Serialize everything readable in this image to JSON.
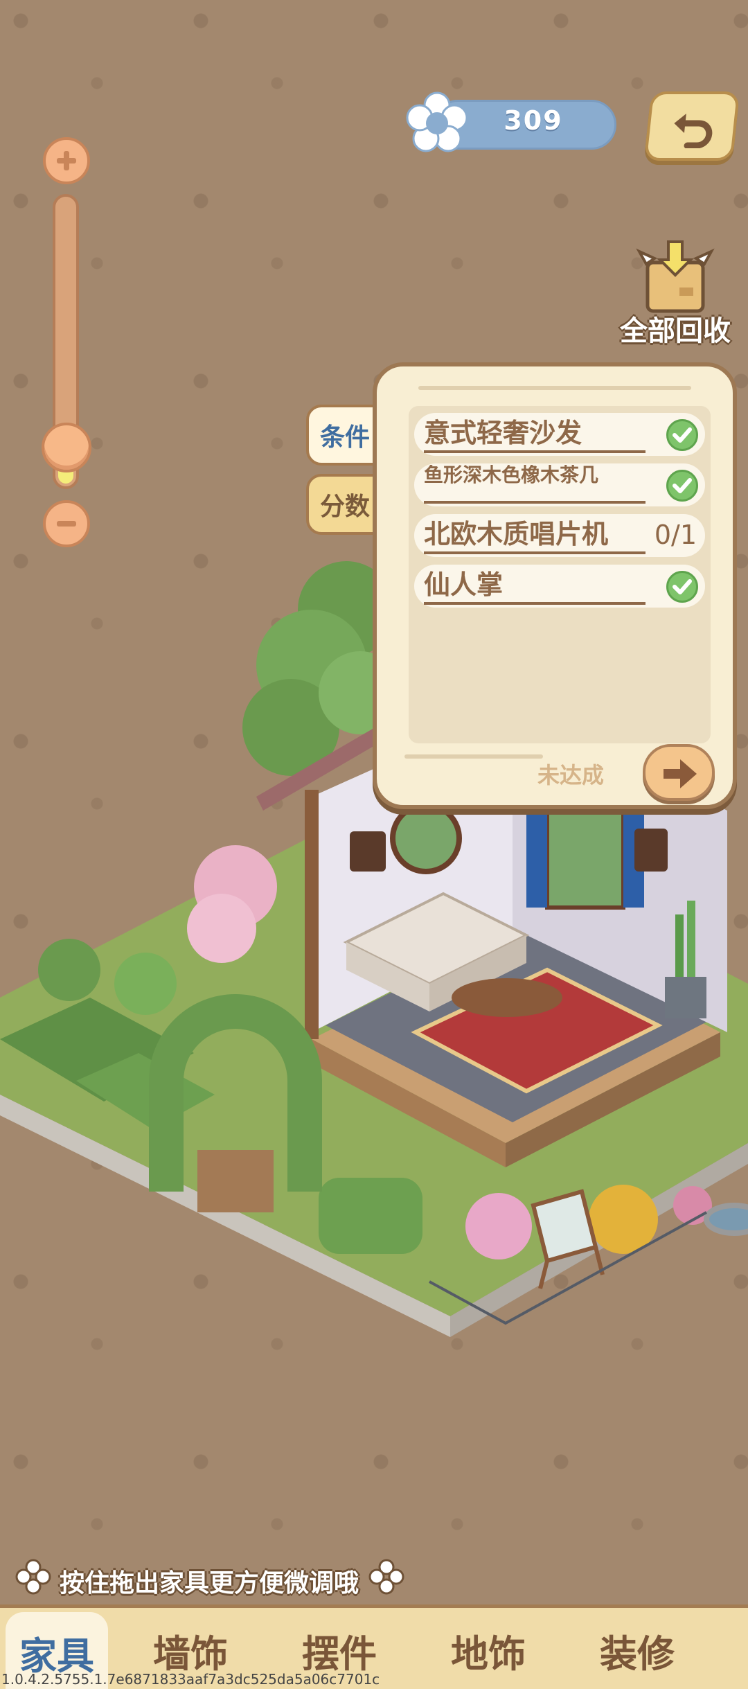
{
  "currency": {
    "value": "309",
    "icon": "flower-icon"
  },
  "back_button": {
    "icon": "undo-arrow-icon"
  },
  "recycle": {
    "label": "全部回收",
    "icon": "cardboard-box-icon"
  },
  "zoom": {
    "plus_icon": "plus-icon",
    "minus_icon": "minus-icon",
    "level": 0.14
  },
  "panel": {
    "tabs": [
      {
        "label": "条件"
      },
      {
        "label": "分数"
      }
    ],
    "tasks": [
      {
        "name": "意式轻奢沙发",
        "done": true
      },
      {
        "name": "鱼形深木色橡木茶几",
        "done": true
      },
      {
        "name": "北欧木质唱片机",
        "progress": "0/1",
        "done": false
      },
      {
        "name": "仙人掌",
        "done": true
      }
    ],
    "status": "未达成",
    "go_icon": "right-arrow-icon"
  },
  "hint": {
    "text": "按住拖出家具更方便微调哦"
  },
  "nav": {
    "items": [
      {
        "label": "家具"
      },
      {
        "label": "墙饰"
      },
      {
        "label": "摆件"
      },
      {
        "label": "地饰"
      },
      {
        "label": "装修"
      }
    ]
  },
  "version": "1.0.4.2.5755.1.7e6871833aaf7a3dc525da5a06c7701c",
  "colors": {
    "background": "#a3886e",
    "accent_blue": "#8aaccf",
    "panel": "#f8eed3",
    "check_green": "#7ec46a"
  }
}
